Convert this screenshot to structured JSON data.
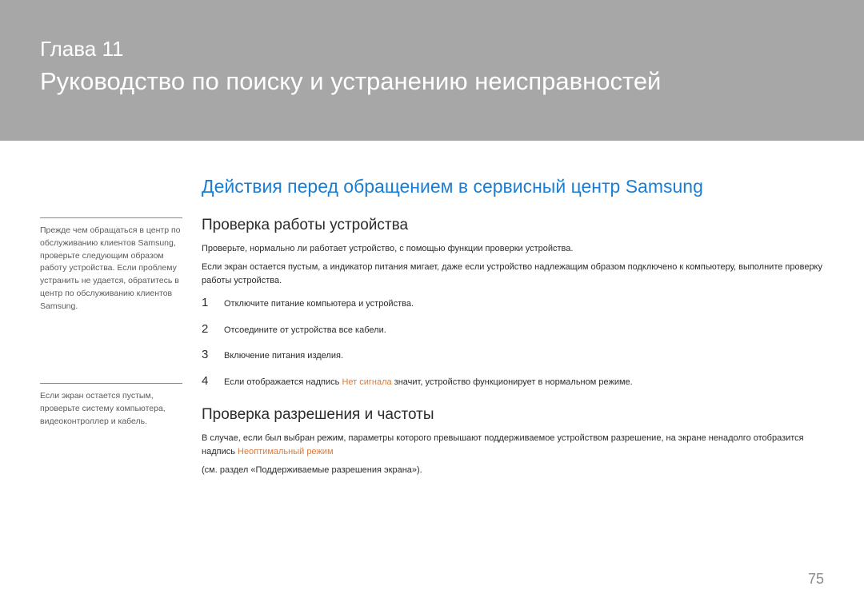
{
  "header": {
    "chapter_label": "Глава 11",
    "chapter_title": "Руководство по поиску и устранению неисправностей"
  },
  "sidebar": {
    "note1": "Прежде чем обращаться в центр по обслуживанию клиентов Samsung, проверьте следующим образом работу устройства. Если проблему устранить не удается, обратитесь в центр по обслуживанию клиентов Samsung.",
    "note2": "Если экран остается пустым, проверьте систему компьютера, видеоконтроллер и кабель."
  },
  "main": {
    "section_heading": "Действия перед обращением в сервисный центр Samsung",
    "sub1_heading": "Проверка работы устройства",
    "sub1_p1": "Проверьте, нормально ли работает устройство, с помощью функции проверки устройства.",
    "sub1_p2": "Если экран остается пустым, а индикатор питания мигает, даже если устройство надлежащим образом подключено к компьютеру, выполните проверку работы устройства.",
    "steps": [
      {
        "num": "1",
        "text_before": "Отключите питание компьютера и устройства.",
        "highlight": "",
        "text_after": ""
      },
      {
        "num": "2",
        "text_before": "Отсоедините от устройства все кабели.",
        "highlight": "",
        "text_after": ""
      },
      {
        "num": "3",
        "text_before": "Включение питания изделия.",
        "highlight": "",
        "text_after": ""
      },
      {
        "num": "4",
        "text_before": "Если отображается надпись ",
        "highlight": "Нет сигнала",
        "text_after": " значит, устройство функционирует в нормальном режиме."
      }
    ],
    "sub2_heading": "Проверка разрешения и частоты",
    "sub2_p1_before": "В случае, если был выбран режим, параметры которого превышают поддерживаемое устройством разрешение, на экране ненадолго отобразится надпись ",
    "sub2_p1_highlight": "Неоптимальный режим",
    "sub2_p2": "(см. раздел «Поддерживаемые разрешения экрана»)."
  },
  "page_number": "75"
}
